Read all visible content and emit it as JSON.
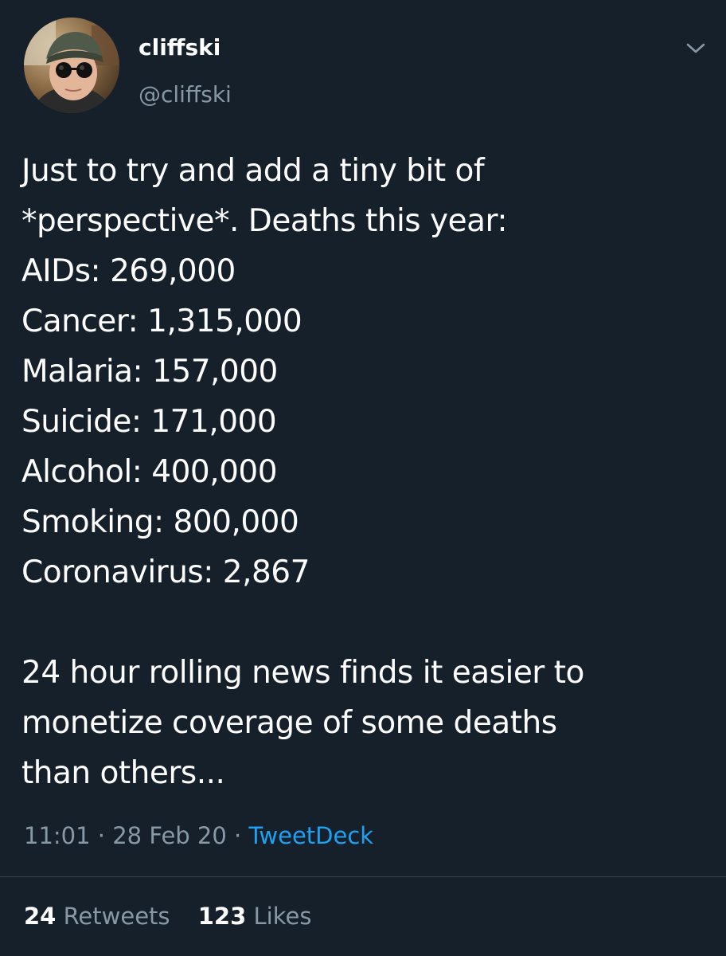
{
  "tweet": {
    "author": {
      "name": "cliffski",
      "handle": "@cliffski"
    },
    "text_lines": [
      "Just to try and add a tiny bit of",
      "*perspective*. Deaths this year:",
      "AIDs: 269,000",
      "Cancer: 1,315,000",
      "Malaria: 157,000",
      "Suicide: 171,000",
      "Alcohol: 400,000",
      "Smoking: 800,000",
      "Coronavirus: 2,867",
      "",
      "24 hour rolling news finds it easier to",
      "monetize coverage of some deaths",
      "than others..."
    ],
    "meta": {
      "time": "11:01",
      "separator": "·",
      "date": "28 Feb 20",
      "source": "TweetDeck"
    },
    "stats": {
      "retweets_count": "24",
      "retweets_label": "Retweets",
      "likes_count": "123",
      "likes_label": "Likes"
    },
    "icons": {
      "more": "chevron-down-icon"
    }
  },
  "colors": {
    "background": "#15202b",
    "text_primary": "#ffffff",
    "text_secondary": "#8899a6",
    "link": "#1da1f2",
    "divider": "#38444d"
  }
}
